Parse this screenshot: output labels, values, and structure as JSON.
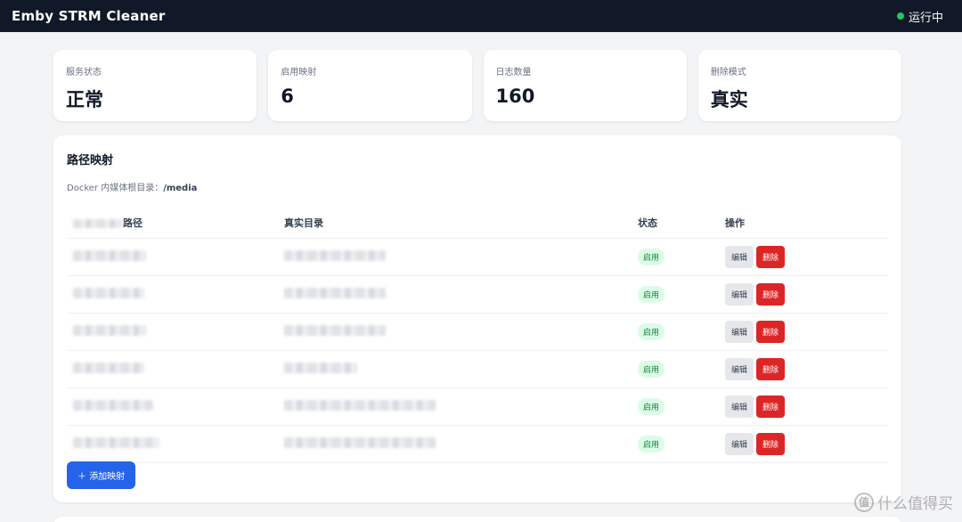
{
  "header": {
    "title": "Emby STRM Cleaner",
    "status_text": "运行中",
    "status_color": "#22c55e"
  },
  "stats": [
    {
      "label": "服务状态",
      "value": "正常"
    },
    {
      "label": "启用映射",
      "value": "6"
    },
    {
      "label": "日志数量",
      "value": "160"
    },
    {
      "label": "删除模式",
      "value": "真实"
    }
  ],
  "mappings": {
    "title": "路径映射",
    "docker_root_label": "Docker 内媒体根目录：",
    "docker_root_value": "/media",
    "columns": {
      "emby_path": "路径",
      "real_dir": "真实目录",
      "state": "状态",
      "actions": "操作"
    },
    "rows": [
      {
        "state": "启用",
        "edit": "编辑",
        "delete": "删除"
      },
      {
        "state": "启用",
        "edit": "编辑",
        "delete": "删除"
      },
      {
        "state": "启用",
        "edit": "编辑",
        "delete": "删除"
      },
      {
        "state": "启用",
        "edit": "编辑",
        "delete": "删除"
      },
      {
        "state": "启用",
        "edit": "编辑",
        "delete": "删除"
      },
      {
        "state": "启用",
        "edit": "编辑",
        "delete": "删除"
      }
    ],
    "add_button": "添加映射",
    "add_icon": "plus-icon"
  },
  "watermark": {
    "text": "什么值得买",
    "icon": "zdm-logo-icon"
  },
  "colors": {
    "accent": "#2563eb",
    "danger": "#dc2626",
    "badge_bg": "#dcfce7",
    "badge_text": "#15803d",
    "header_bg": "#111827"
  }
}
